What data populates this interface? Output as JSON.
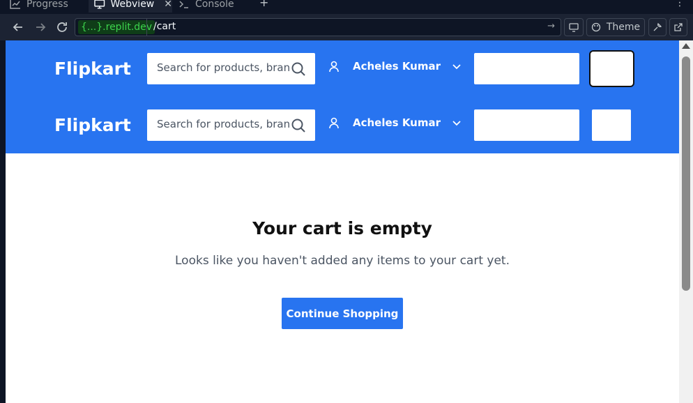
{
  "ide": {
    "tabs": [
      {
        "label": "Progress",
        "icon": "progress-icon"
      },
      {
        "label": "Webview",
        "icon": "monitor-icon",
        "active": true
      },
      {
        "label": "Console",
        "icon": "terminal-icon"
      }
    ],
    "add_tab": "+",
    "more": "⋮",
    "address": {
      "domain": "{...}.replit.dev",
      "path": "/cart"
    },
    "theme_label": "Theme",
    "colors": {
      "accent_green": "#3dd34d",
      "bg": "#0e1525",
      "panel": "#1c2333"
    }
  },
  "site": {
    "colors": {
      "brand": "#2874f0"
    },
    "headers": [
      {
        "logo": "Flipkart",
        "search_placeholder": "Search for products, brands and more",
        "user_name": "Acheles Kumar"
      },
      {
        "logo": "Flipkart",
        "search_placeholder": "Search for products, brands and more",
        "user_name": "Acheles Kumar"
      }
    ],
    "cart": {
      "title": "Your cart is empty",
      "subtitle": "Looks like you haven't added any items to your cart yet.",
      "button": "Continue Shopping"
    }
  }
}
